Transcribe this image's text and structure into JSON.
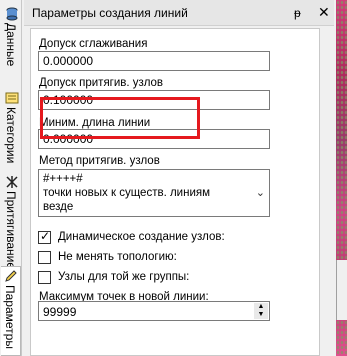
{
  "tabs": [
    {
      "label": "Данные",
      "icon": "database-icon"
    },
    {
      "label": "Категории",
      "icon": "categories-icon"
    },
    {
      "label": "Притягивание",
      "icon": "snap-icon"
    },
    {
      "label": "Параметры",
      "icon": "pencil-icon"
    }
  ],
  "panel": {
    "title": "Параметры создания линий",
    "pin_glyph": "ᵽ",
    "close_glyph": "✕"
  },
  "fields": {
    "smoothing_label": "Допуск сглаживания",
    "smoothing_value": "0.000000",
    "snap_label": "Допуск притягив. узлов",
    "snap_value": "0.100000",
    "min_length_label": "Миним. длина линии",
    "min_length_value": "0.000000",
    "method_label": "Метод притягив. узлов",
    "method_line1": "#++++#",
    "method_line2": "точки новых к существ. линиям",
    "method_line3": "везде",
    "dynamic_nodes_label": "Динамическое создание узлов:",
    "dynamic_nodes_checked": true,
    "keep_topology_label": "Не менять топологию:",
    "keep_topology_checked": false,
    "same_group_label": "Узлы для той же группы:",
    "same_group_checked": false,
    "max_points_label": "Максимум точек в новой линии:",
    "max_points_value": "99999"
  },
  "colors": {
    "highlight": "#e5191e"
  }
}
